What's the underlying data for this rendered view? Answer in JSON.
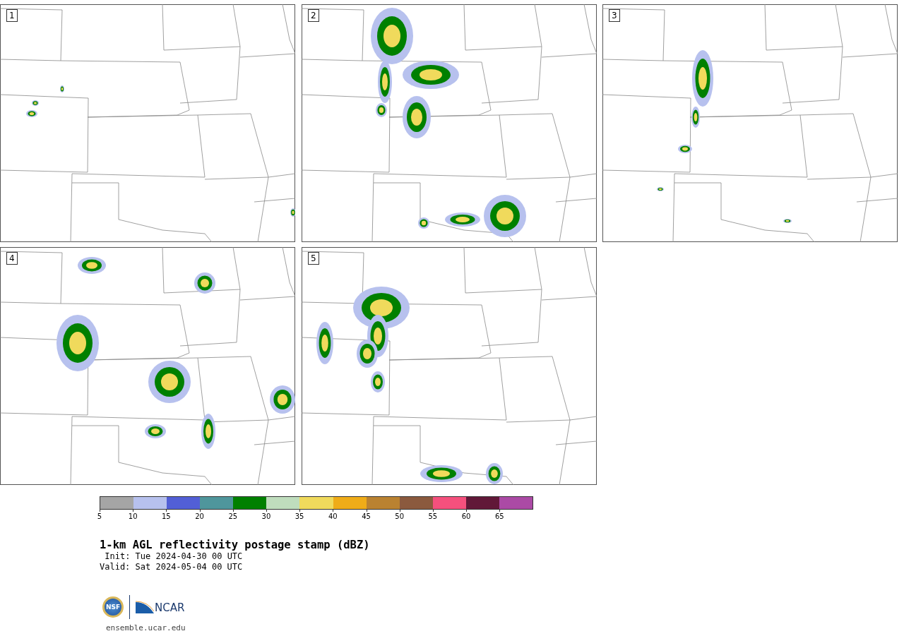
{
  "panels": [
    {
      "label": "1"
    },
    {
      "label": "2"
    },
    {
      "label": "3"
    },
    {
      "label": "4"
    },
    {
      "label": "5"
    }
  ],
  "colorbar": {
    "bins": [
      {
        "color": "#a5a5a5"
      },
      {
        "color": "#b7c1ee"
      },
      {
        "color": "#525fd6"
      },
      {
        "color": "#4f969c"
      },
      {
        "color": "#008000"
      },
      {
        "color": "#bfddbd"
      },
      {
        "color": "#f0da5c"
      },
      {
        "color": "#efac18"
      },
      {
        "color": "#ba8231"
      },
      {
        "color": "#8b5a3e"
      },
      {
        "color": "#f5507d"
      },
      {
        "color": "#611838"
      },
      {
        "color": "#ab4aa5"
      }
    ],
    "ticks": [
      "5",
      "10",
      "15",
      "20",
      "25",
      "30",
      "35",
      "40",
      "45",
      "50",
      "55",
      "60",
      "65"
    ]
  },
  "title": "1-km AGL reflectivity postage stamp (dBZ)",
  "init": "Init: Tue 2024-04-30 00 UTC",
  "valid": "Valid: Sat 2024-05-04 00 UTC",
  "logos": {
    "left": "NSF",
    "right": "NCAR"
  },
  "url": "ensemble.ucar.edu"
}
